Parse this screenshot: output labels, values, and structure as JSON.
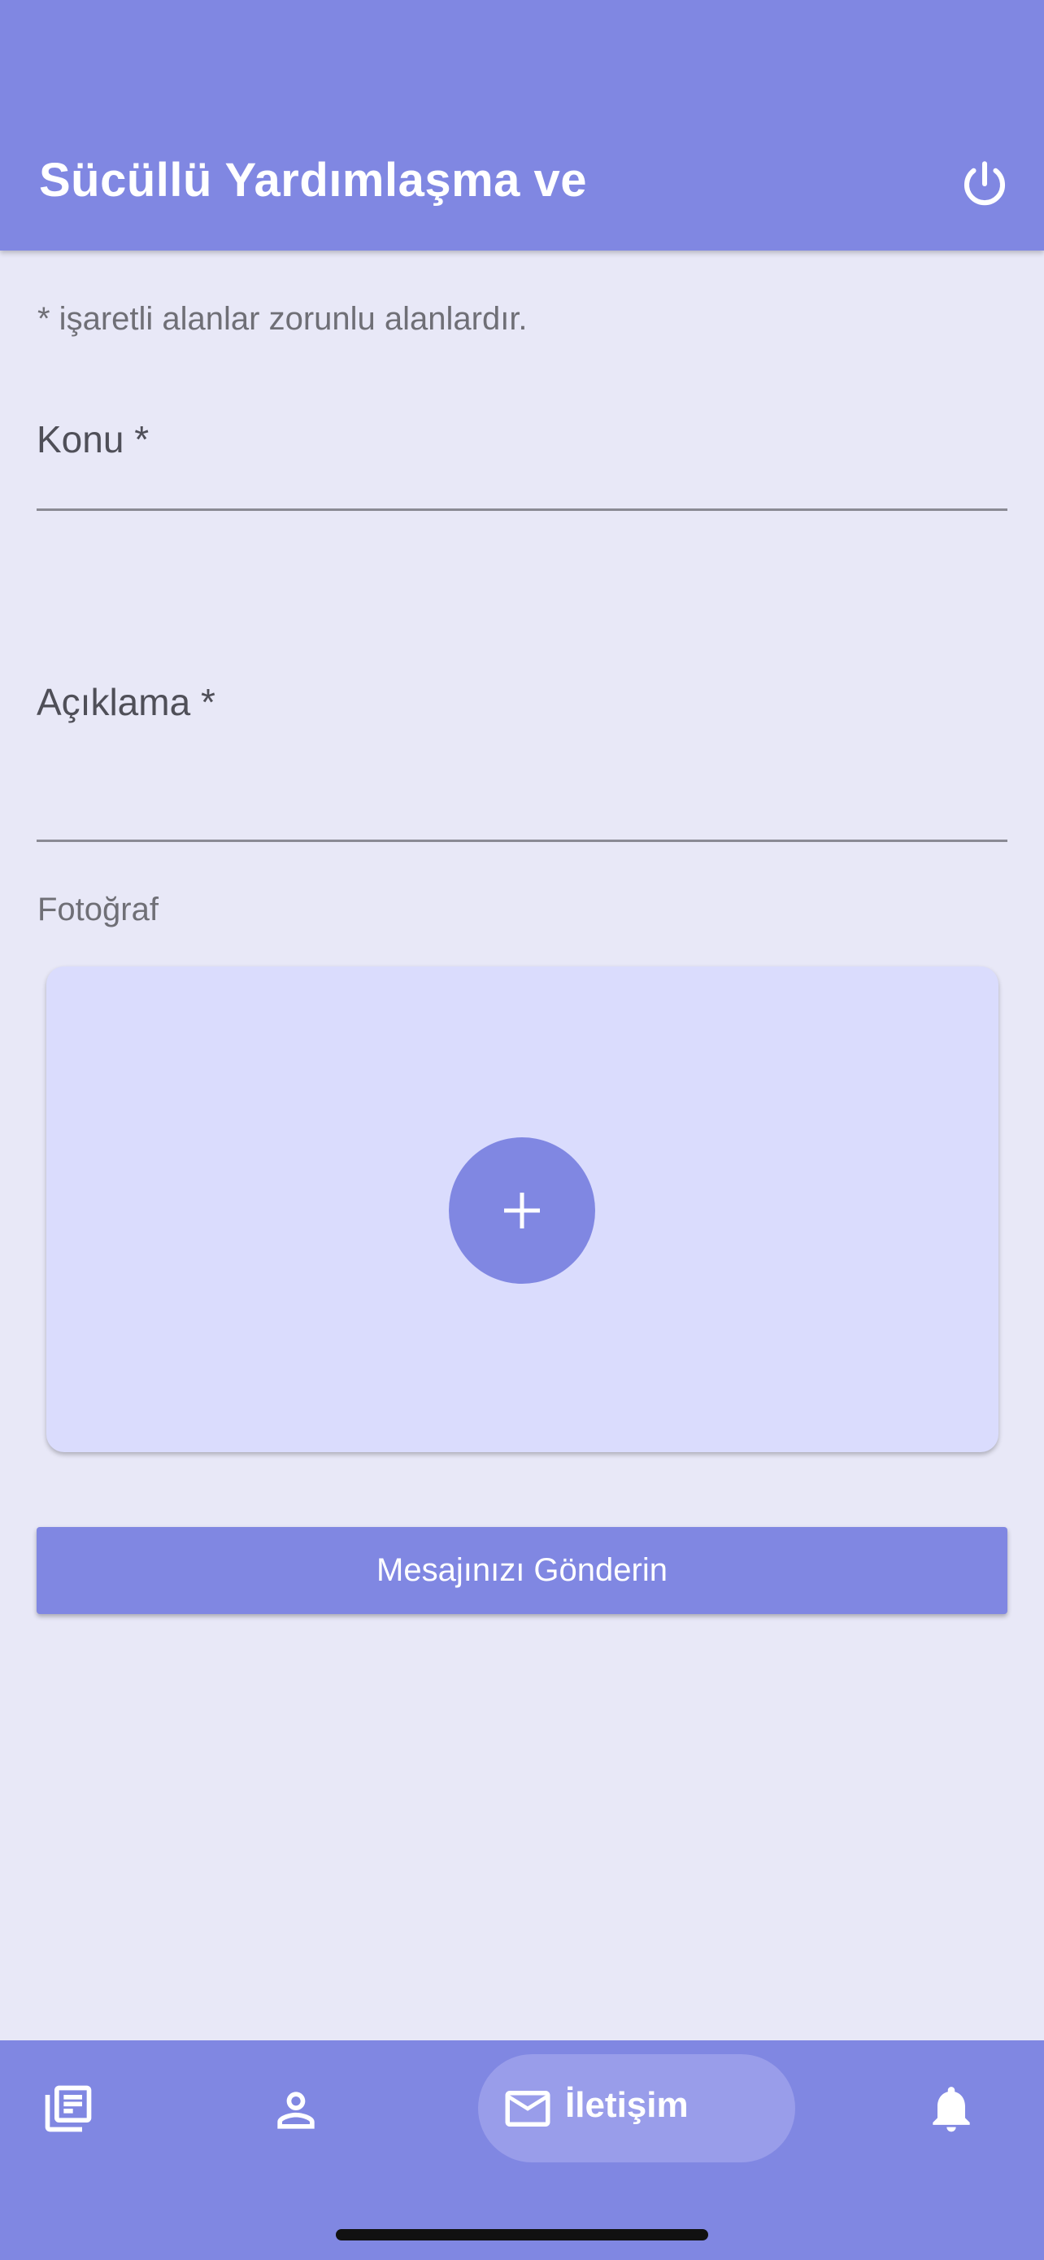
{
  "app_bar": {
    "title": "Sücüllü Yardımlaşma ve",
    "logout_icon": "power-icon",
    "background_color": "#8087e2"
  },
  "form": {
    "required_hint": "* işaretli alanlar zorunlu alanlardır.",
    "subject_label": "Konu *",
    "subject_value": "",
    "description_label": "Açıklama *",
    "description_value": "",
    "photo_label": "Fotoğraf",
    "add_photo_icon": "plus-icon",
    "submit_label": "Mesajınızı Gönderin"
  },
  "bottom_nav": {
    "items": [
      {
        "icon": "newspaper-icon",
        "label": "",
        "active": false
      },
      {
        "icon": "person-icon",
        "label": "",
        "active": false
      },
      {
        "icon": "mail-icon",
        "label": "İletişim",
        "active": true
      },
      {
        "icon": "bell-icon",
        "label": "",
        "active": false
      }
    ]
  },
  "colors": {
    "accent": "#8087e2",
    "page_background": "#e8e8f7",
    "photo_card_background": "#dadcfd",
    "active_pill": "#999dea"
  }
}
